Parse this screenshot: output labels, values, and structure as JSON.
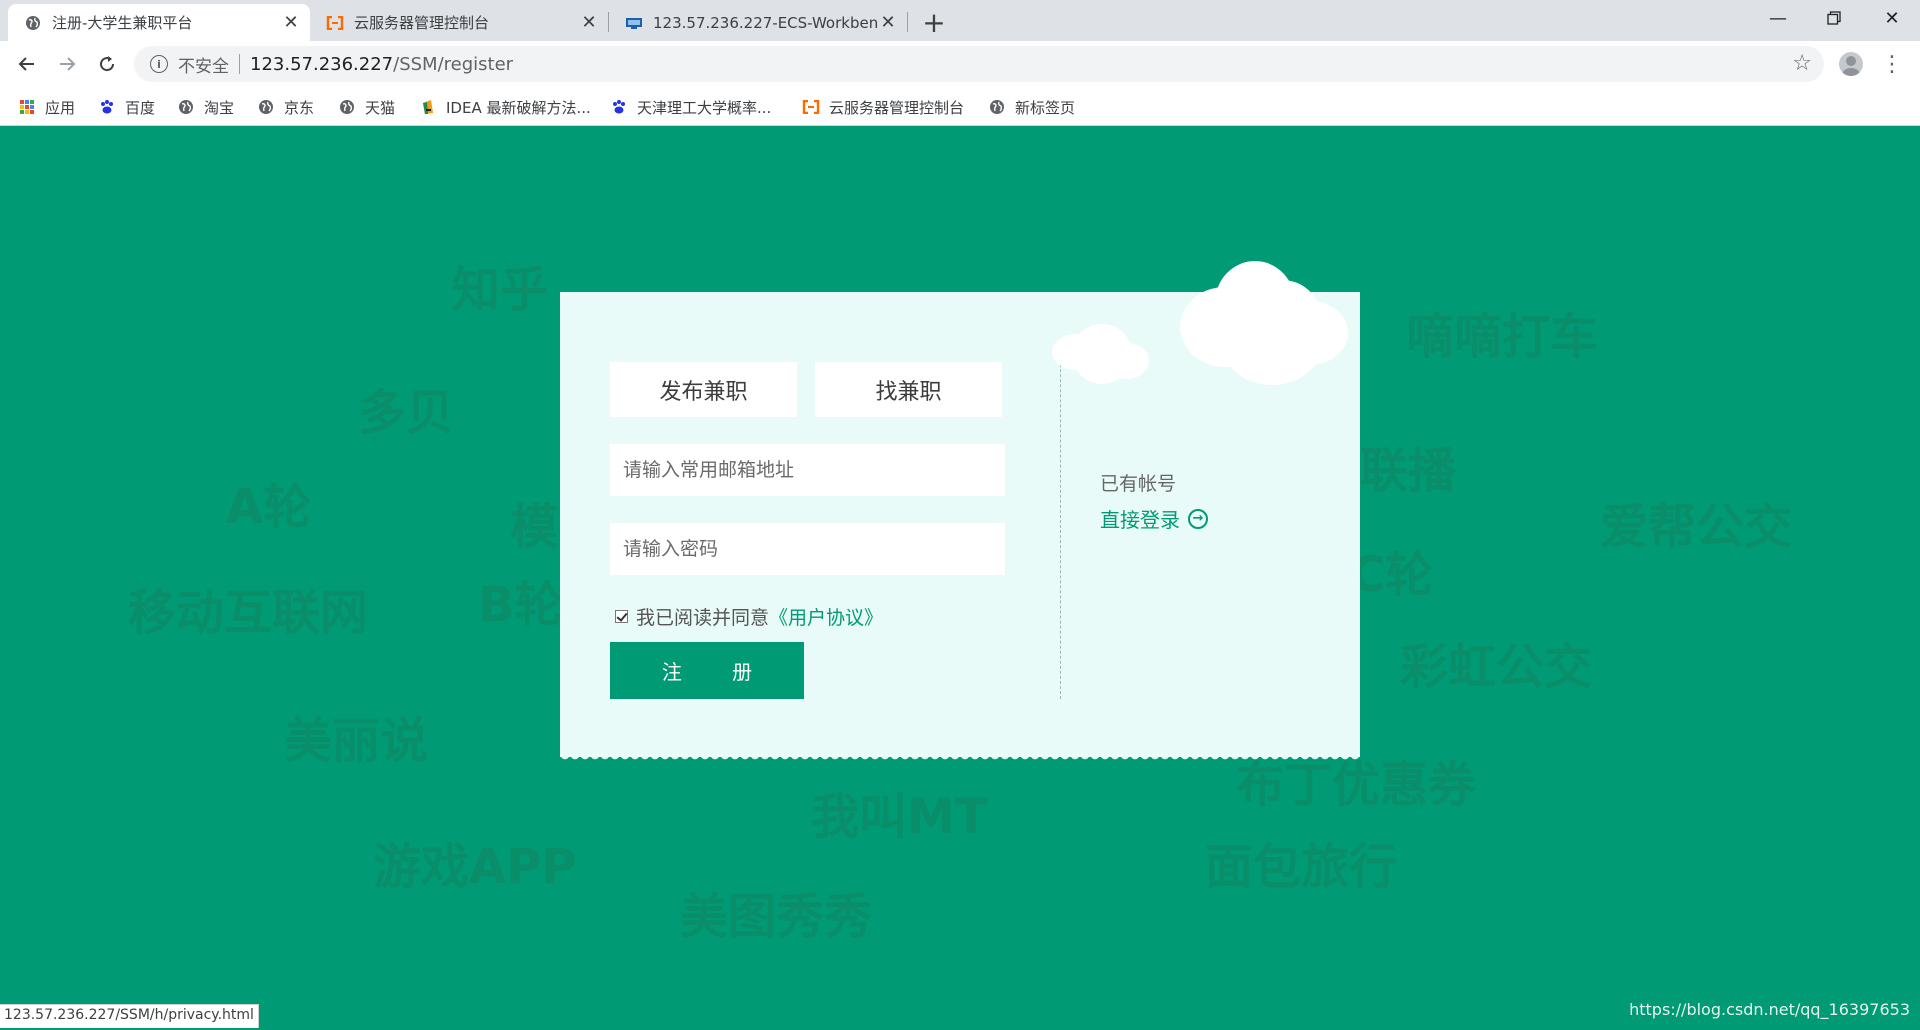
{
  "browser": {
    "tabs": [
      {
        "title": "注册-大学生兼职平台",
        "icon": "globe-icon"
      },
      {
        "title": "云服务器管理控制台",
        "icon": "aliyun-icon"
      },
      {
        "title": "123.57.236.227-ECS-Workbenc",
        "icon": "remote-desktop-icon"
      }
    ],
    "address": {
      "security_label": "不安全",
      "host": "123.57.236.227",
      "path": "/SSM/register"
    },
    "bookmarks": [
      {
        "label": "应用",
        "icon": "apps-grid-icon"
      },
      {
        "label": "百度",
        "icon": "baidu-paw-icon"
      },
      {
        "label": "淘宝",
        "icon": "globe-icon"
      },
      {
        "label": "京东",
        "icon": "globe-icon"
      },
      {
        "label": "天猫",
        "icon": "globe-icon"
      },
      {
        "label": "IDEA 最新破解方法...",
        "icon": "idea-icon"
      },
      {
        "label": "天津理工大学概率...",
        "icon": "baidu-paw-icon"
      },
      {
        "label": "云服务器管理控制台",
        "icon": "aliyun-icon"
      },
      {
        "label": "新标签页",
        "icon": "globe-icon"
      }
    ],
    "status_url": "123.57.236.227/SSM/h/privacy.html"
  },
  "background_words": [
    "知乎",
    "多贝",
    "A轮",
    "模",
    "B轮",
    "移动互联网",
    "美丽说",
    "游戏APP",
    "美图秀秀",
    "我叫MT",
    "面包旅行",
    "布丁优惠券",
    "彩虹公交",
    "C轮",
    "爱帮公交",
    "联播",
    "嘀嘀打车"
  ],
  "register": {
    "role_publish": "发布兼职",
    "role_find": "找兼职",
    "email_placeholder": "请输入常用邮箱地址",
    "password_placeholder": "请输入密码",
    "agree_text": "我已阅读并同意",
    "agree_link": "《用户协议》",
    "agree_checked": true,
    "submit_label": "注 册",
    "have_account": "已有帐号",
    "login_link": "直接登录"
  },
  "watermark": "https://blog.csdn.net/qq_16397653",
  "colors": {
    "accent": "#009a75",
    "card": "#e8fbf8"
  }
}
